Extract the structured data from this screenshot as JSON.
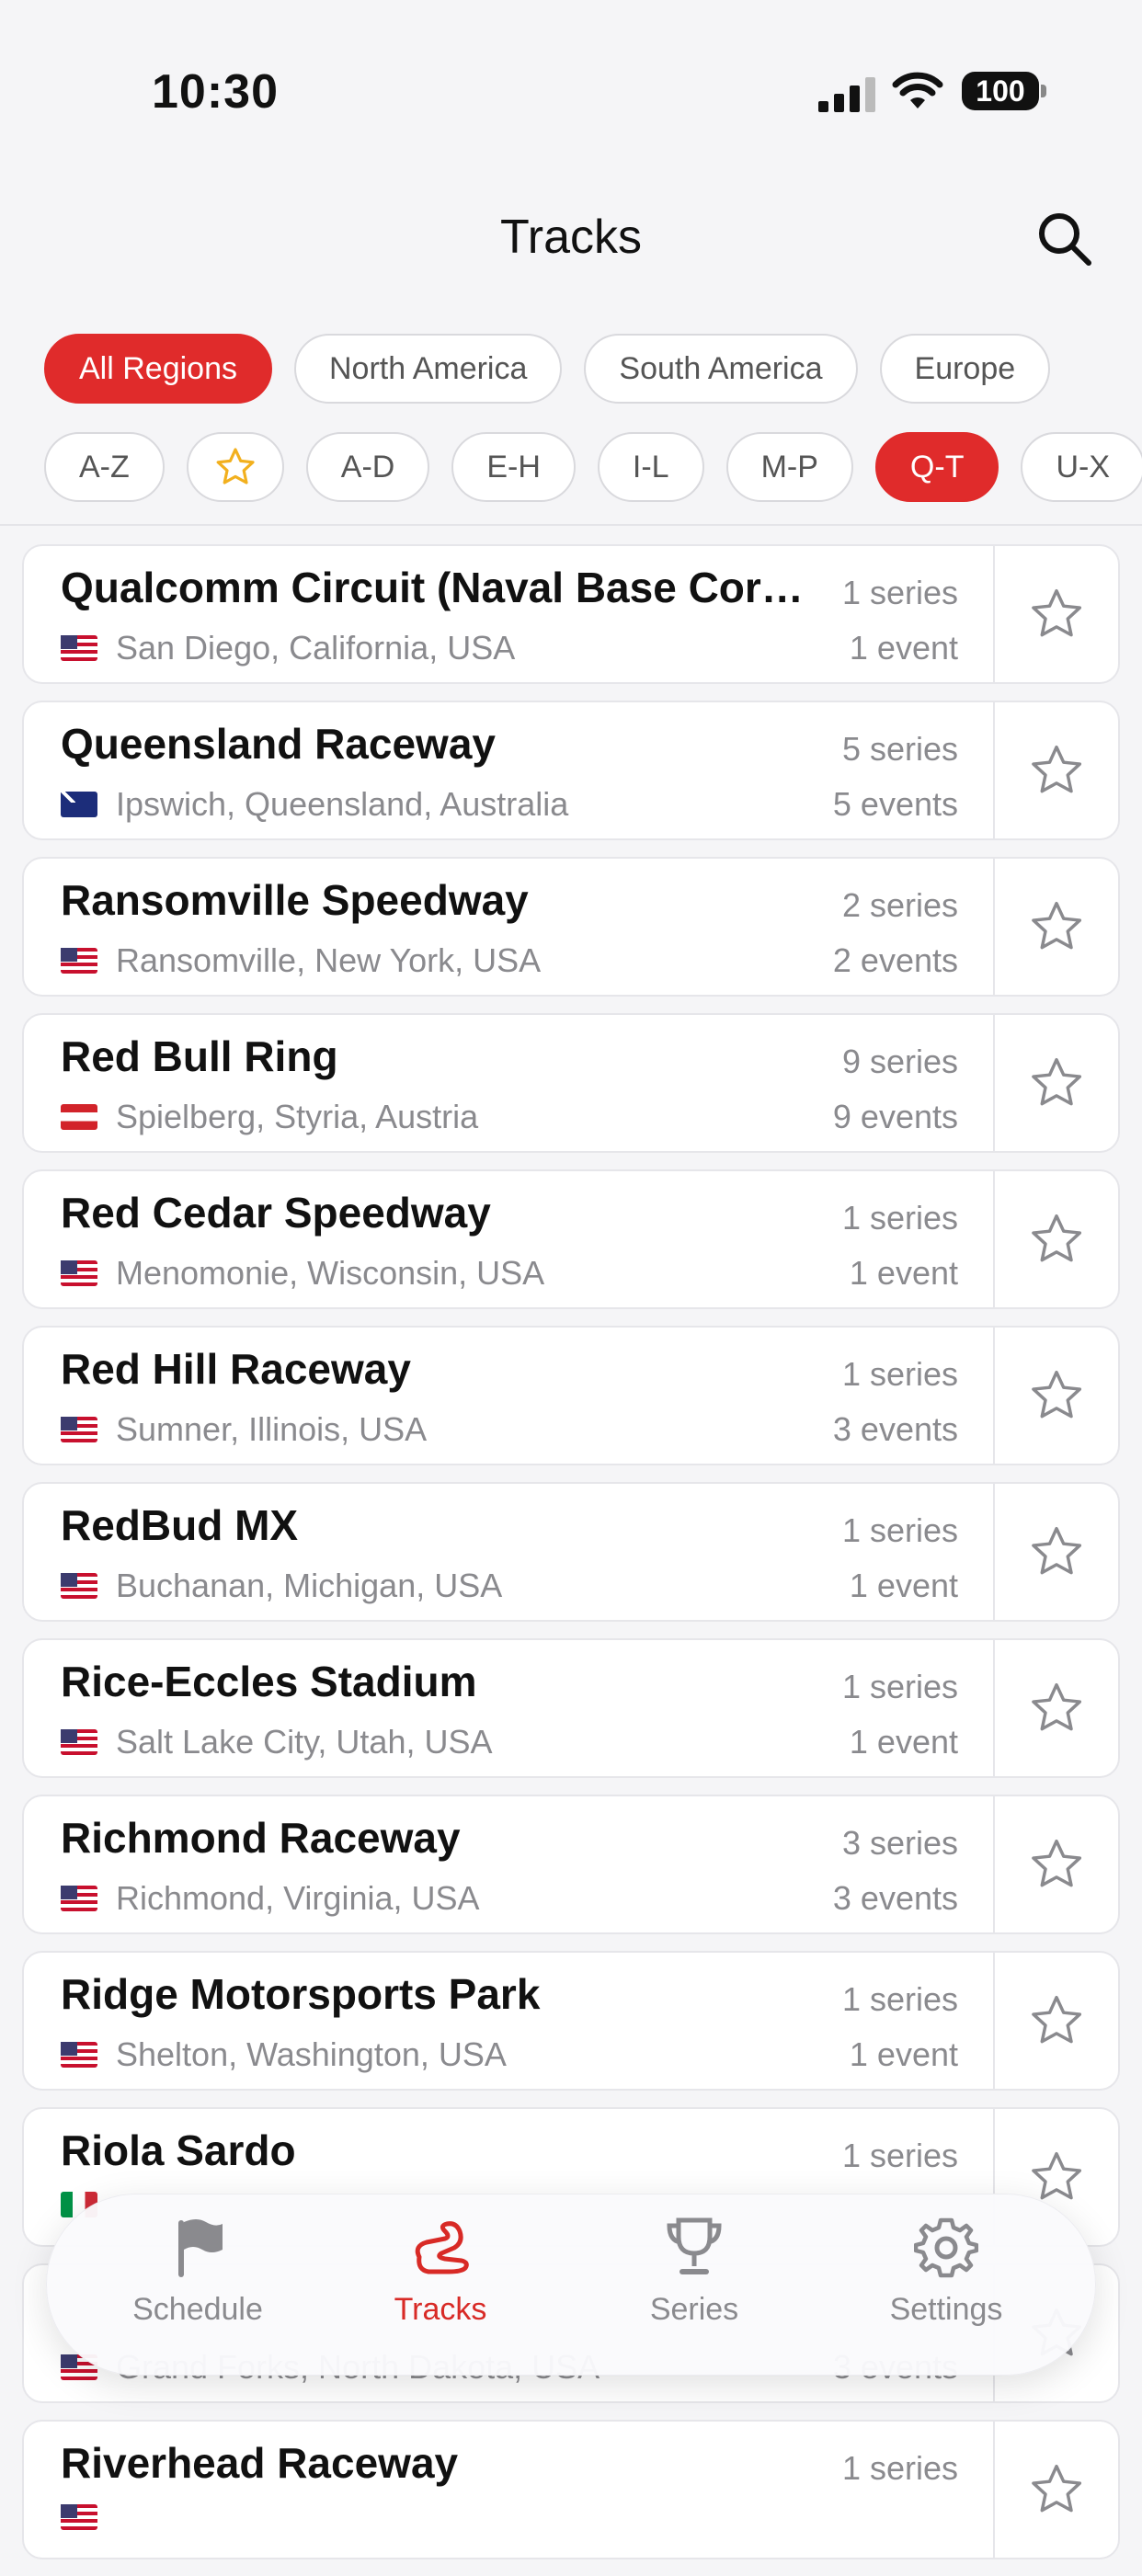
{
  "status": {
    "time": "10:30",
    "battery": "100"
  },
  "header": {
    "title": "Tracks"
  },
  "regions": [
    "All Regions",
    "North America",
    "South America",
    "Europe"
  ],
  "regions_active": 0,
  "letters": [
    "A-Z",
    "★",
    "A-D",
    "E-H",
    "I-L",
    "M-P",
    "Q-T",
    "U-X"
  ],
  "letters_active": 6,
  "tracks": [
    {
      "name": "Qualcomm Circuit (Naval Base Coronado)",
      "flag": "us",
      "location": "San Diego, California, USA",
      "series": "1 series",
      "events": "1 event"
    },
    {
      "name": "Queensland Raceway",
      "flag": "au",
      "location": "Ipswich, Queensland, Australia",
      "series": "5 series",
      "events": "5 events"
    },
    {
      "name": "Ransomville Speedway",
      "flag": "us",
      "location": "Ransomville, New York, USA",
      "series": "2 series",
      "events": "2 events"
    },
    {
      "name": "Red Bull Ring",
      "flag": "at",
      "location": "Spielberg, Styria, Austria",
      "series": "9 series",
      "events": "9 events"
    },
    {
      "name": "Red Cedar Speedway",
      "flag": "us",
      "location": "Menomonie, Wisconsin, USA",
      "series": "1 series",
      "events": "1 event"
    },
    {
      "name": "Red Hill Raceway",
      "flag": "us",
      "location": "Sumner, Illinois, USA",
      "series": "1 series",
      "events": "3 events"
    },
    {
      "name": "RedBud MX",
      "flag": "us",
      "location": "Buchanan, Michigan, USA",
      "series": "1 series",
      "events": "1 event"
    },
    {
      "name": "Rice-Eccles Stadium",
      "flag": "us",
      "location": "Salt Lake City, Utah, USA",
      "series": "1 series",
      "events": "1 event"
    },
    {
      "name": "Richmond Raceway",
      "flag": "us",
      "location": "Richmond, Virginia, USA",
      "series": "3 series",
      "events": "3 events"
    },
    {
      "name": "Ridge Motorsports Park",
      "flag": "us",
      "location": "Shelton, Washington, USA",
      "series": "1 series",
      "events": "1 event"
    },
    {
      "name": "Riola Sardo",
      "flag": "it",
      "location": "",
      "series": "1 series",
      "events": ""
    },
    {
      "name": "",
      "flag": "us",
      "location": "Grand Forks, North Dakota, USA",
      "series": "",
      "events": "3 events"
    },
    {
      "name": "Riverhead Raceway",
      "flag": "us",
      "location": "",
      "series": "1 series",
      "events": ""
    }
  ],
  "tabs": [
    {
      "label": "Schedule",
      "icon": "flag-icon",
      "active": false
    },
    {
      "label": "Tracks",
      "icon": "track-icon",
      "active": true
    },
    {
      "label": "Series",
      "icon": "trophy-icon",
      "active": false
    },
    {
      "label": "Settings",
      "icon": "gear-icon",
      "active": false
    }
  ],
  "colors": {
    "accent": "#e02b2b",
    "muted": "#8a8a8e",
    "star_filled": "#f2b01e"
  }
}
